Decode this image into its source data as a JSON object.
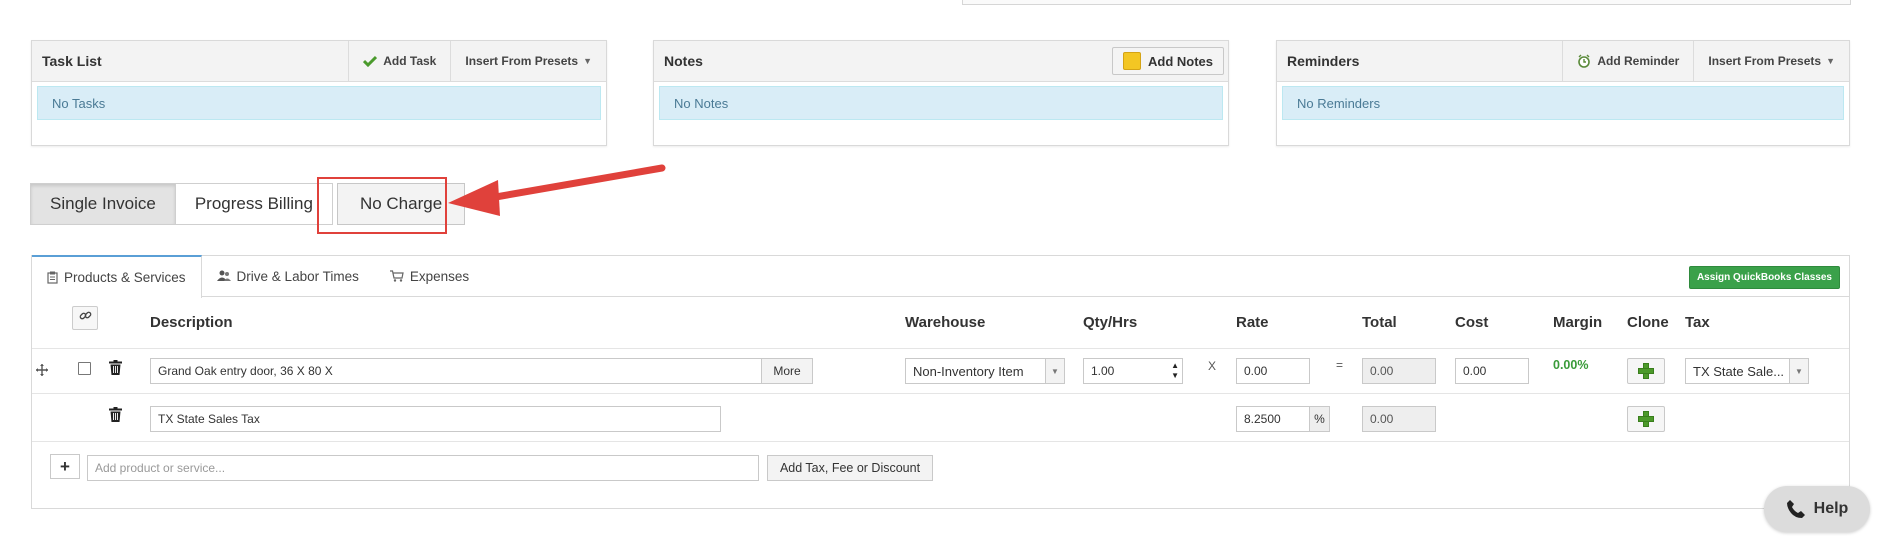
{
  "task_list": {
    "title": "Task List",
    "add_label": "Add Task",
    "presets_label": "Insert From Presets",
    "empty_text": "No Tasks"
  },
  "notes": {
    "title": "Notes",
    "add_label": "Add Notes",
    "empty_text": "No Notes"
  },
  "reminders": {
    "title": "Reminders",
    "add_label": "Add Reminder",
    "presets_label": "Insert From Presets",
    "empty_text": "No Reminders"
  },
  "invoice_types": [
    "Single Invoice",
    "Progress Billing",
    "No Charge"
  ],
  "tabs": {
    "products": "Products & Services",
    "drive_labor": "Drive & Labor Times",
    "expenses": "Expenses"
  },
  "assign_qb_label": "Assign QuickBooks Classes",
  "columns": {
    "description": "Description",
    "warehouse": "Warehouse",
    "qty": "Qty/Hrs",
    "rate": "Rate",
    "total": "Total",
    "cost": "Cost",
    "margin": "Margin",
    "clone": "Clone",
    "tax": "Tax"
  },
  "line_item": {
    "description": "Grand Oak entry door, 36 X 80 X",
    "more_label": "More",
    "warehouse": "Non-Inventory Item",
    "qty": "1.00",
    "times_symbol": "X",
    "rate": "0.00",
    "equals_symbol": "=",
    "total": "0.00",
    "cost": "0.00",
    "margin": "0.00%",
    "tax": "TX State Sale..."
  },
  "tax_row": {
    "description": "TX State Sales Tax",
    "rate": "8.2500",
    "percent_symbol": "%",
    "total": "0.00"
  },
  "add_row": {
    "plus_label": "+",
    "placeholder": "Add product or service...",
    "add_tax_label": "Add Tax, Fee or Discount"
  },
  "help_label": "Help",
  "colors": {
    "accent_red": "#e0413b",
    "qb_green": "#3aa14a",
    "margin_green": "#3a9b3a",
    "empty_bg": "#d9edf7"
  }
}
